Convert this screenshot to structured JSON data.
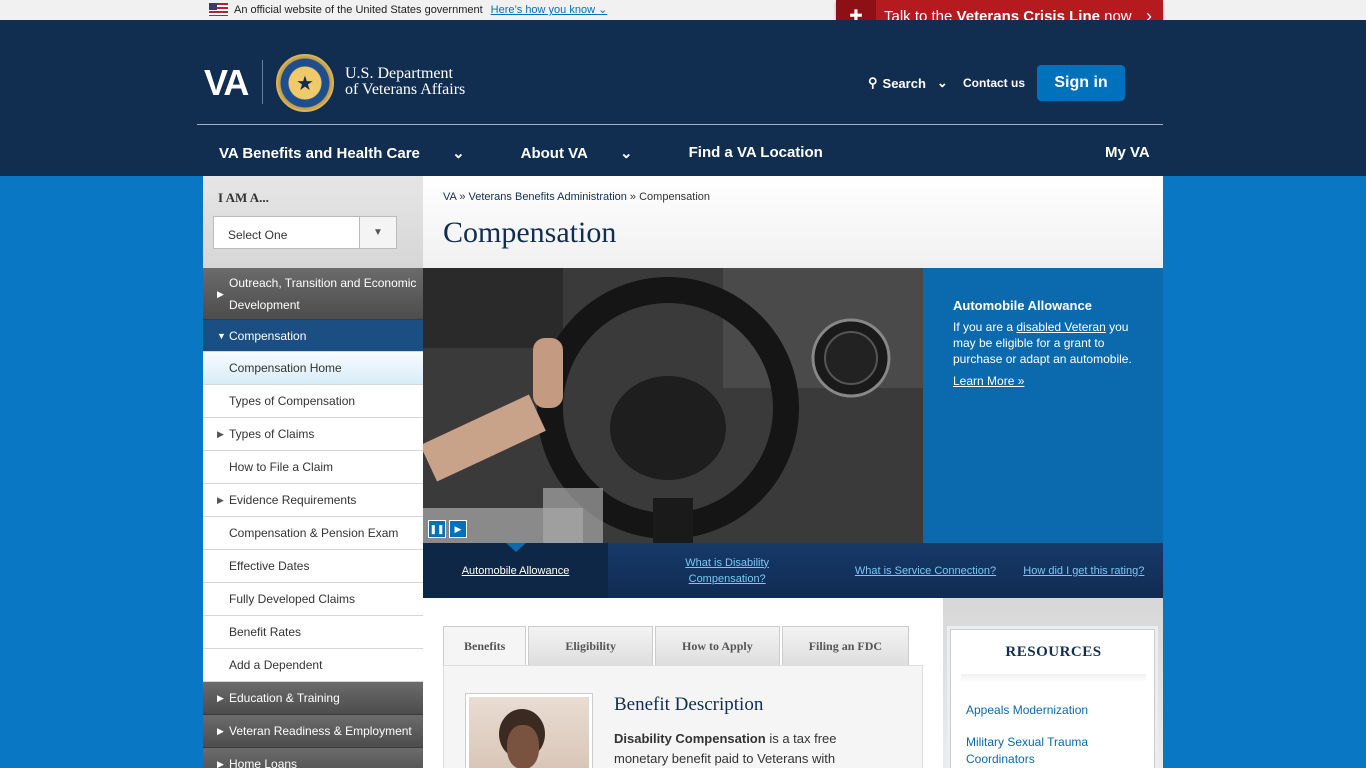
{
  "gov_banner": {
    "text": "An official website of the United States government",
    "link": "Here’s how you know"
  },
  "crisis": {
    "prefix": "Talk to the ",
    "bold": "Veterans Crisis Line",
    "suffix": " now"
  },
  "header": {
    "logo": "VA",
    "dept_line1": "U.S. Department",
    "dept_line2": "of Veterans Affairs",
    "search": "Search",
    "contact": "Contact us",
    "signin": "Sign in"
  },
  "nav": {
    "items": [
      "VA Benefits and Health Care",
      "About VA",
      "Find a VA Location"
    ],
    "myva": "My VA"
  },
  "sidebar": {
    "iam_label": "I AM A...",
    "select_value": "Select One",
    "items": [
      "Outreach, Transition and Economic Development",
      "Compensation",
      "Compensation Home",
      "Types of Compensation",
      "Types of Claims",
      "How to File a Claim",
      "Evidence Requirements",
      "Compensation & Pension Exam",
      "Effective Dates",
      "Fully Developed Claims",
      "Benefit Rates",
      "Add a Dependent",
      "Education & Training",
      "Veteran Readiness & Employment",
      "Home Loans"
    ]
  },
  "breadcrumb": {
    "va": "VA",
    "sep1": " » ",
    "vba": "Veterans Benefits Administration",
    "sep2": " » ",
    "current": "Compensation"
  },
  "page_title": "Compensation",
  "hero": {
    "title": "Automobile Allowance",
    "text1": "If you are a ",
    "link": "disabled Veteran",
    "text2": " you may be eligible for a grant to purchase or adapt an automobile.",
    "learn": "Learn More »"
  },
  "slide_tabs": [
    "Automobile Allowance",
    "What is Disability Compensation?",
    "What is Service Connection?",
    "How did I get this rating?"
  ],
  "content_tabs": [
    "Benefits",
    "Eligibility",
    "How to Apply",
    "Filing an FDC"
  ],
  "benefit": {
    "title": "Benefit Description",
    "bold": "Disability Compensation",
    "text": " is a tax free monetary benefit paid to Veterans with"
  },
  "resources": {
    "title": "RESOURCES",
    "links": [
      "Appeals Modernization",
      "Military Sexual Trauma Coordinators"
    ]
  },
  "colors": {
    "header_bg": "#112e51",
    "primary_blue": "#0071bb",
    "crisis_red": "#b51a1f",
    "page_bg": "#0a77c4"
  }
}
